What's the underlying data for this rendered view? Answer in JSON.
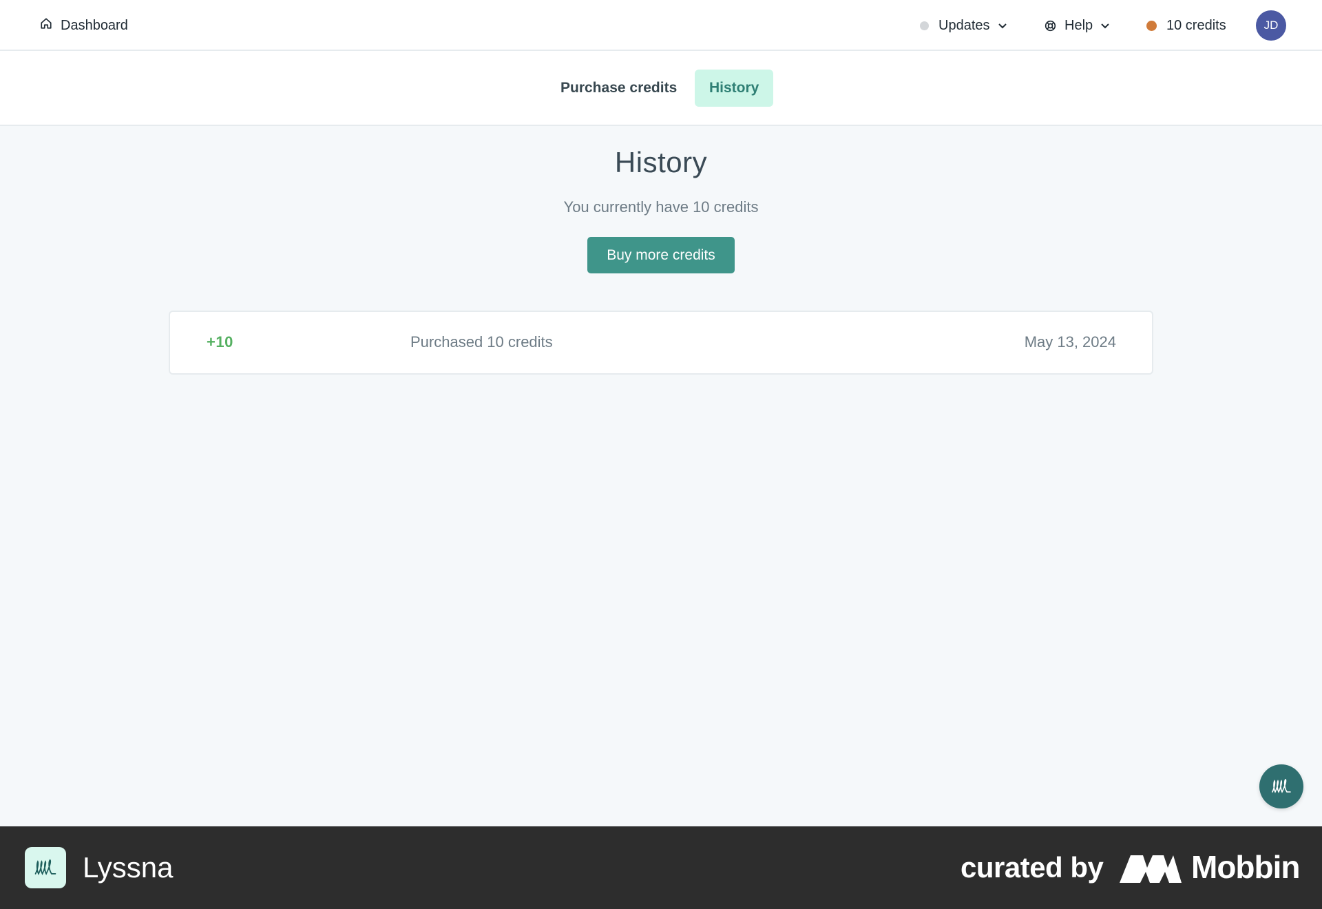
{
  "topbar": {
    "dashboard_label": "Dashboard",
    "updates_label": "Updates",
    "help_label": "Help",
    "credits_label": "10 credits",
    "avatar_initials": "JD"
  },
  "tabs": [
    {
      "label": "Purchase credits",
      "active": false
    },
    {
      "label": "History",
      "active": true
    }
  ],
  "main": {
    "title": "History",
    "subtitle": "You currently have 10 credits",
    "buy_button_label": "Buy more credits"
  },
  "history": [
    {
      "amount": "+10",
      "description": "Purchased 10 credits",
      "date": "May 13, 2024"
    }
  ],
  "footer": {
    "brand_name": "Lyssna",
    "curated_label": "curated by",
    "curator_name": "Mobbin"
  },
  "colors": {
    "accent": "#3f958a",
    "active_tab_bg": "#cdf6e8",
    "positive_amount": "#55b061",
    "credits_dot": "#d07b3a",
    "avatar_bg": "#4b59a3"
  },
  "icons": {
    "dashboard": "home-icon",
    "updates": "status-dot-icon",
    "help": "lifebuoy-icon",
    "credits": "credit-coin-icon",
    "chat": "lyssna-chat-icon"
  }
}
